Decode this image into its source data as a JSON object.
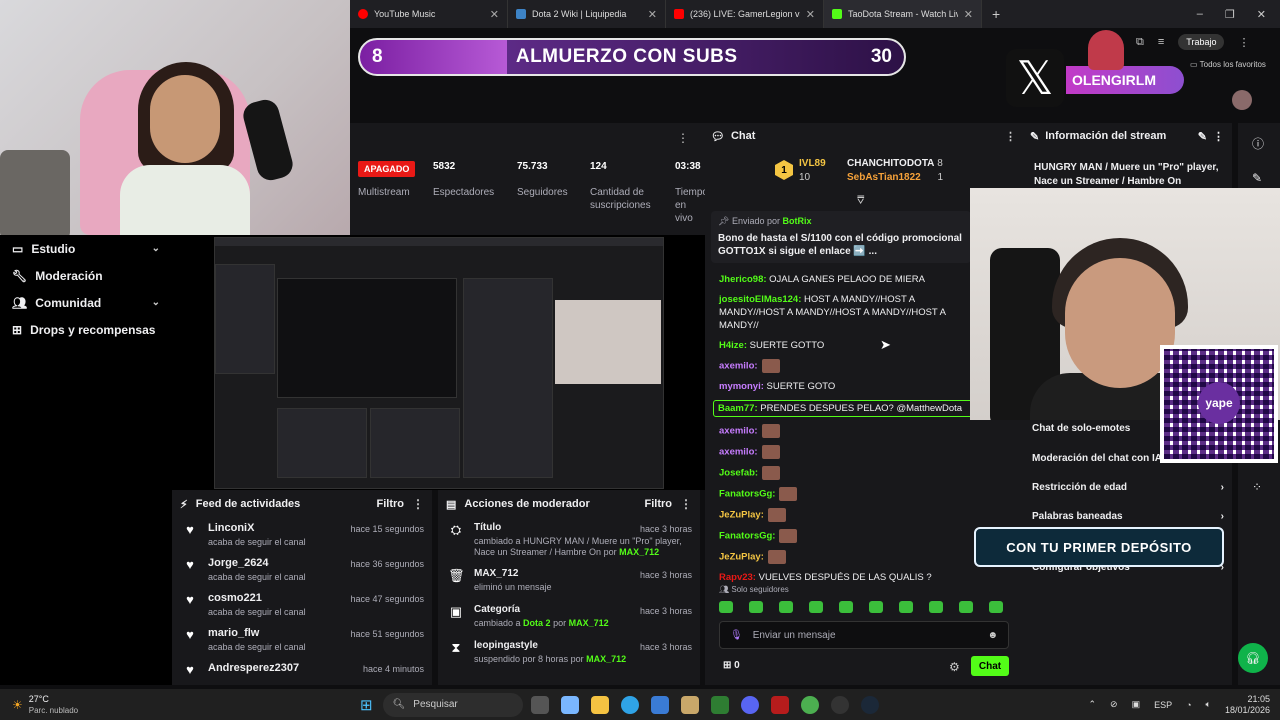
{
  "browser_tabs": [
    {
      "label": "YouTube Music",
      "color": "#ff0000"
    },
    {
      "label": "Dota 2 Wiki | Liquipedia",
      "color": "#3d83c6"
    },
    {
      "label": "(236) LIVE: GamerLegion vs Rol",
      "color": "#ff0000"
    },
    {
      "label": "TaoDota Stream - Watch Live o",
      "color": "#53fc18"
    }
  ],
  "browser": {
    "profile_label": "Trabajo",
    "bookmarks_label": "Todos los favoritos"
  },
  "overlay": {
    "left_number": "8",
    "title": "ALMUERZO CON SUBS",
    "right_number": "30",
    "progress_fraction": 0.27
  },
  "x_handle": "OLENGIRLM",
  "sidebar": {
    "items": [
      {
        "label": "Estudio",
        "icon": "monitor-icon",
        "chevron": "⌄"
      },
      {
        "label": "Moderación",
        "icon": "wrench-icon",
        "chevron": ""
      },
      {
        "label": "Comunidad",
        "icon": "users-icon",
        "chevron": "⌄"
      },
      {
        "label": "Drops y recompensas",
        "icon": "gift-icon",
        "chevron": ""
      }
    ]
  },
  "stats": {
    "status_badge": "APAGADO",
    "multistream": "Multistream",
    "items": [
      {
        "value": "5832",
        "label": "Espectadores"
      },
      {
        "value": "75.733",
        "label": "Seguidores"
      },
      {
        "value": "124",
        "label": "Cantidad de suscripciones"
      },
      {
        "value": "03:38",
        "label": "Tiempo en vivo"
      }
    ]
  },
  "activity_feed": {
    "title": "Feed de actividades",
    "filter": "Filtro",
    "rows": [
      {
        "name": "LinconiX",
        "sub": "acaba de seguir el canal",
        "time": "hace 15 segundos"
      },
      {
        "name": "Jorge_2624",
        "sub": "acaba de seguir el canal",
        "time": "hace 36 segundos"
      },
      {
        "name": "cosmo221",
        "sub": "acaba de seguir el canal",
        "time": "hace 47 segundos"
      },
      {
        "name": "mario_flw",
        "sub": "acaba de seguir el canal",
        "time": "hace 51 segundos"
      },
      {
        "name": "Andresperez2307",
        "sub": "",
        "time": "hace 4 minutos"
      }
    ]
  },
  "mod_actions": {
    "title": "Acciones de moderador",
    "filter": "Filtro",
    "rows": [
      {
        "name": "Título",
        "sub_pre": "cambiado a HUNGRY MAN / Muere un \"Pro\" player, Nace un Streamer / Hambre On",
        "by": "por",
        "mod": "MAX_712",
        "time": "hace 3 horas",
        "icon": "title-icon"
      },
      {
        "name": "MAX_712",
        "sub_pre": "eliminó un mensaje",
        "by": "",
        "mod": "",
        "time": "hace 3 horas",
        "icon": "trash-icon"
      },
      {
        "name": "Categoría",
        "sub_pre": "cambiado a",
        "cat": "Dota 2",
        "by": "por",
        "mod": "MAX_712",
        "time": "hace 3 horas",
        "icon": "category-icon"
      },
      {
        "name": "leopingastyle",
        "sub_pre": "suspendido por 8 horas por",
        "by": "",
        "mod": "MAX_712",
        "time": "hace 3 horas",
        "icon": "hourglass-icon"
      }
    ]
  },
  "chat": {
    "title": "Chat",
    "top_gifters": [
      {
        "rank": "1",
        "name": "IVL89",
        "count": "10",
        "color": "#f4c543"
      },
      {
        "name": "CHANCHITODOTA",
        "count": "8",
        "color": "#efeff1"
      },
      {
        "name": "SebAsTian1822",
        "count": "1",
        "color": "#f6a23a"
      }
    ],
    "pinned_by": "Enviado por",
    "pinned_user": "BotRix",
    "pinned_message": "Bono de hasta el S/1100 con el código promocional GOTTO1X si sigue el enlace ➡️ ...",
    "messages": [
      {
        "user": "Jherico98:",
        "text": " OJALA GANES PELAOO DE MIERA",
        "color": "#53fc18"
      },
      {
        "user": "josesitoElMas124:",
        "text": " HOST A MANDY//HOST A MANDY//HOST A MANDY//HOST A MANDY//HOST A MANDY//",
        "color": "#53fc18"
      },
      {
        "user": "H4ize:",
        "text": " SUERTE GOTTO",
        "color": "#53fc18"
      },
      {
        "user": "axemilo:",
        "text": "",
        "emote": true,
        "color": "#c77dff"
      },
      {
        "user": "mymonyi:",
        "text": " SUERTE GOTO",
        "color": "#c77dff"
      },
      {
        "user": "Baam77:",
        "text": " PRENDES DESPUES PELAO? @MatthewDota",
        "color": "#53fc18",
        "highlight": true
      },
      {
        "user": "axemilo:",
        "text": "",
        "emote": true,
        "color": "#c77dff"
      },
      {
        "user": "axemilo:",
        "text": "",
        "emote": true,
        "color": "#c77dff"
      },
      {
        "user": "Josefab:",
        "text": "",
        "emote": true,
        "color": "#53fc18"
      },
      {
        "user": "FanatorsGg:",
        "text": "",
        "emote": true,
        "color": "#53fc18"
      },
      {
        "user": "JeZuPlay:",
        "text": "",
        "emote": true,
        "color": "#f4c543"
      },
      {
        "user": "FanatorsGg:",
        "text": "",
        "emote": true,
        "color": "#53fc18"
      },
      {
        "user": "JeZuPlay:",
        "text": "",
        "emote": true,
        "color": "#f4c543"
      },
      {
        "user": "Rapv23:",
        "text": " VUELVES DESPUÉS DE LAS QUALIS ?",
        "color": "#e91916"
      }
    ],
    "followers_only": "Solo seguidores",
    "input_placeholder": "Enviar un mensaje",
    "points": "0",
    "send_label": "Chat"
  },
  "stream_info": {
    "title": "Información del stream",
    "description": "HUNGRY MAN / Muere un \"Pro\" player, Nace un Streamer / Hambre On",
    "options": [
      {
        "label": "Chat de solo-emotes",
        "chevron": ""
      },
      {
        "label": "Moderación del chat con IA",
        "chevron": ""
      },
      {
        "label": "Restricción de edad",
        "chevron": "›"
      },
      {
        "label": "Palabras baneadas",
        "chevron": "›"
      },
      {
        "label": "Configurar objetivos",
        "chevron": "›"
      }
    ]
  },
  "qr_brand": "yape",
  "promo_text": "CON TU PRIMER DEPÓSITO",
  "taskbar": {
    "weather_temp": "27°C",
    "weather_desc": "Parc. nublado",
    "search_placeholder": "Pesquisar",
    "lang": "ESP",
    "time": "21:05",
    "date": "18/01/2026"
  },
  "colors": {
    "accent": "#53fc18",
    "offline": "#e91916",
    "overlay_purple": "#7b1fa2"
  }
}
